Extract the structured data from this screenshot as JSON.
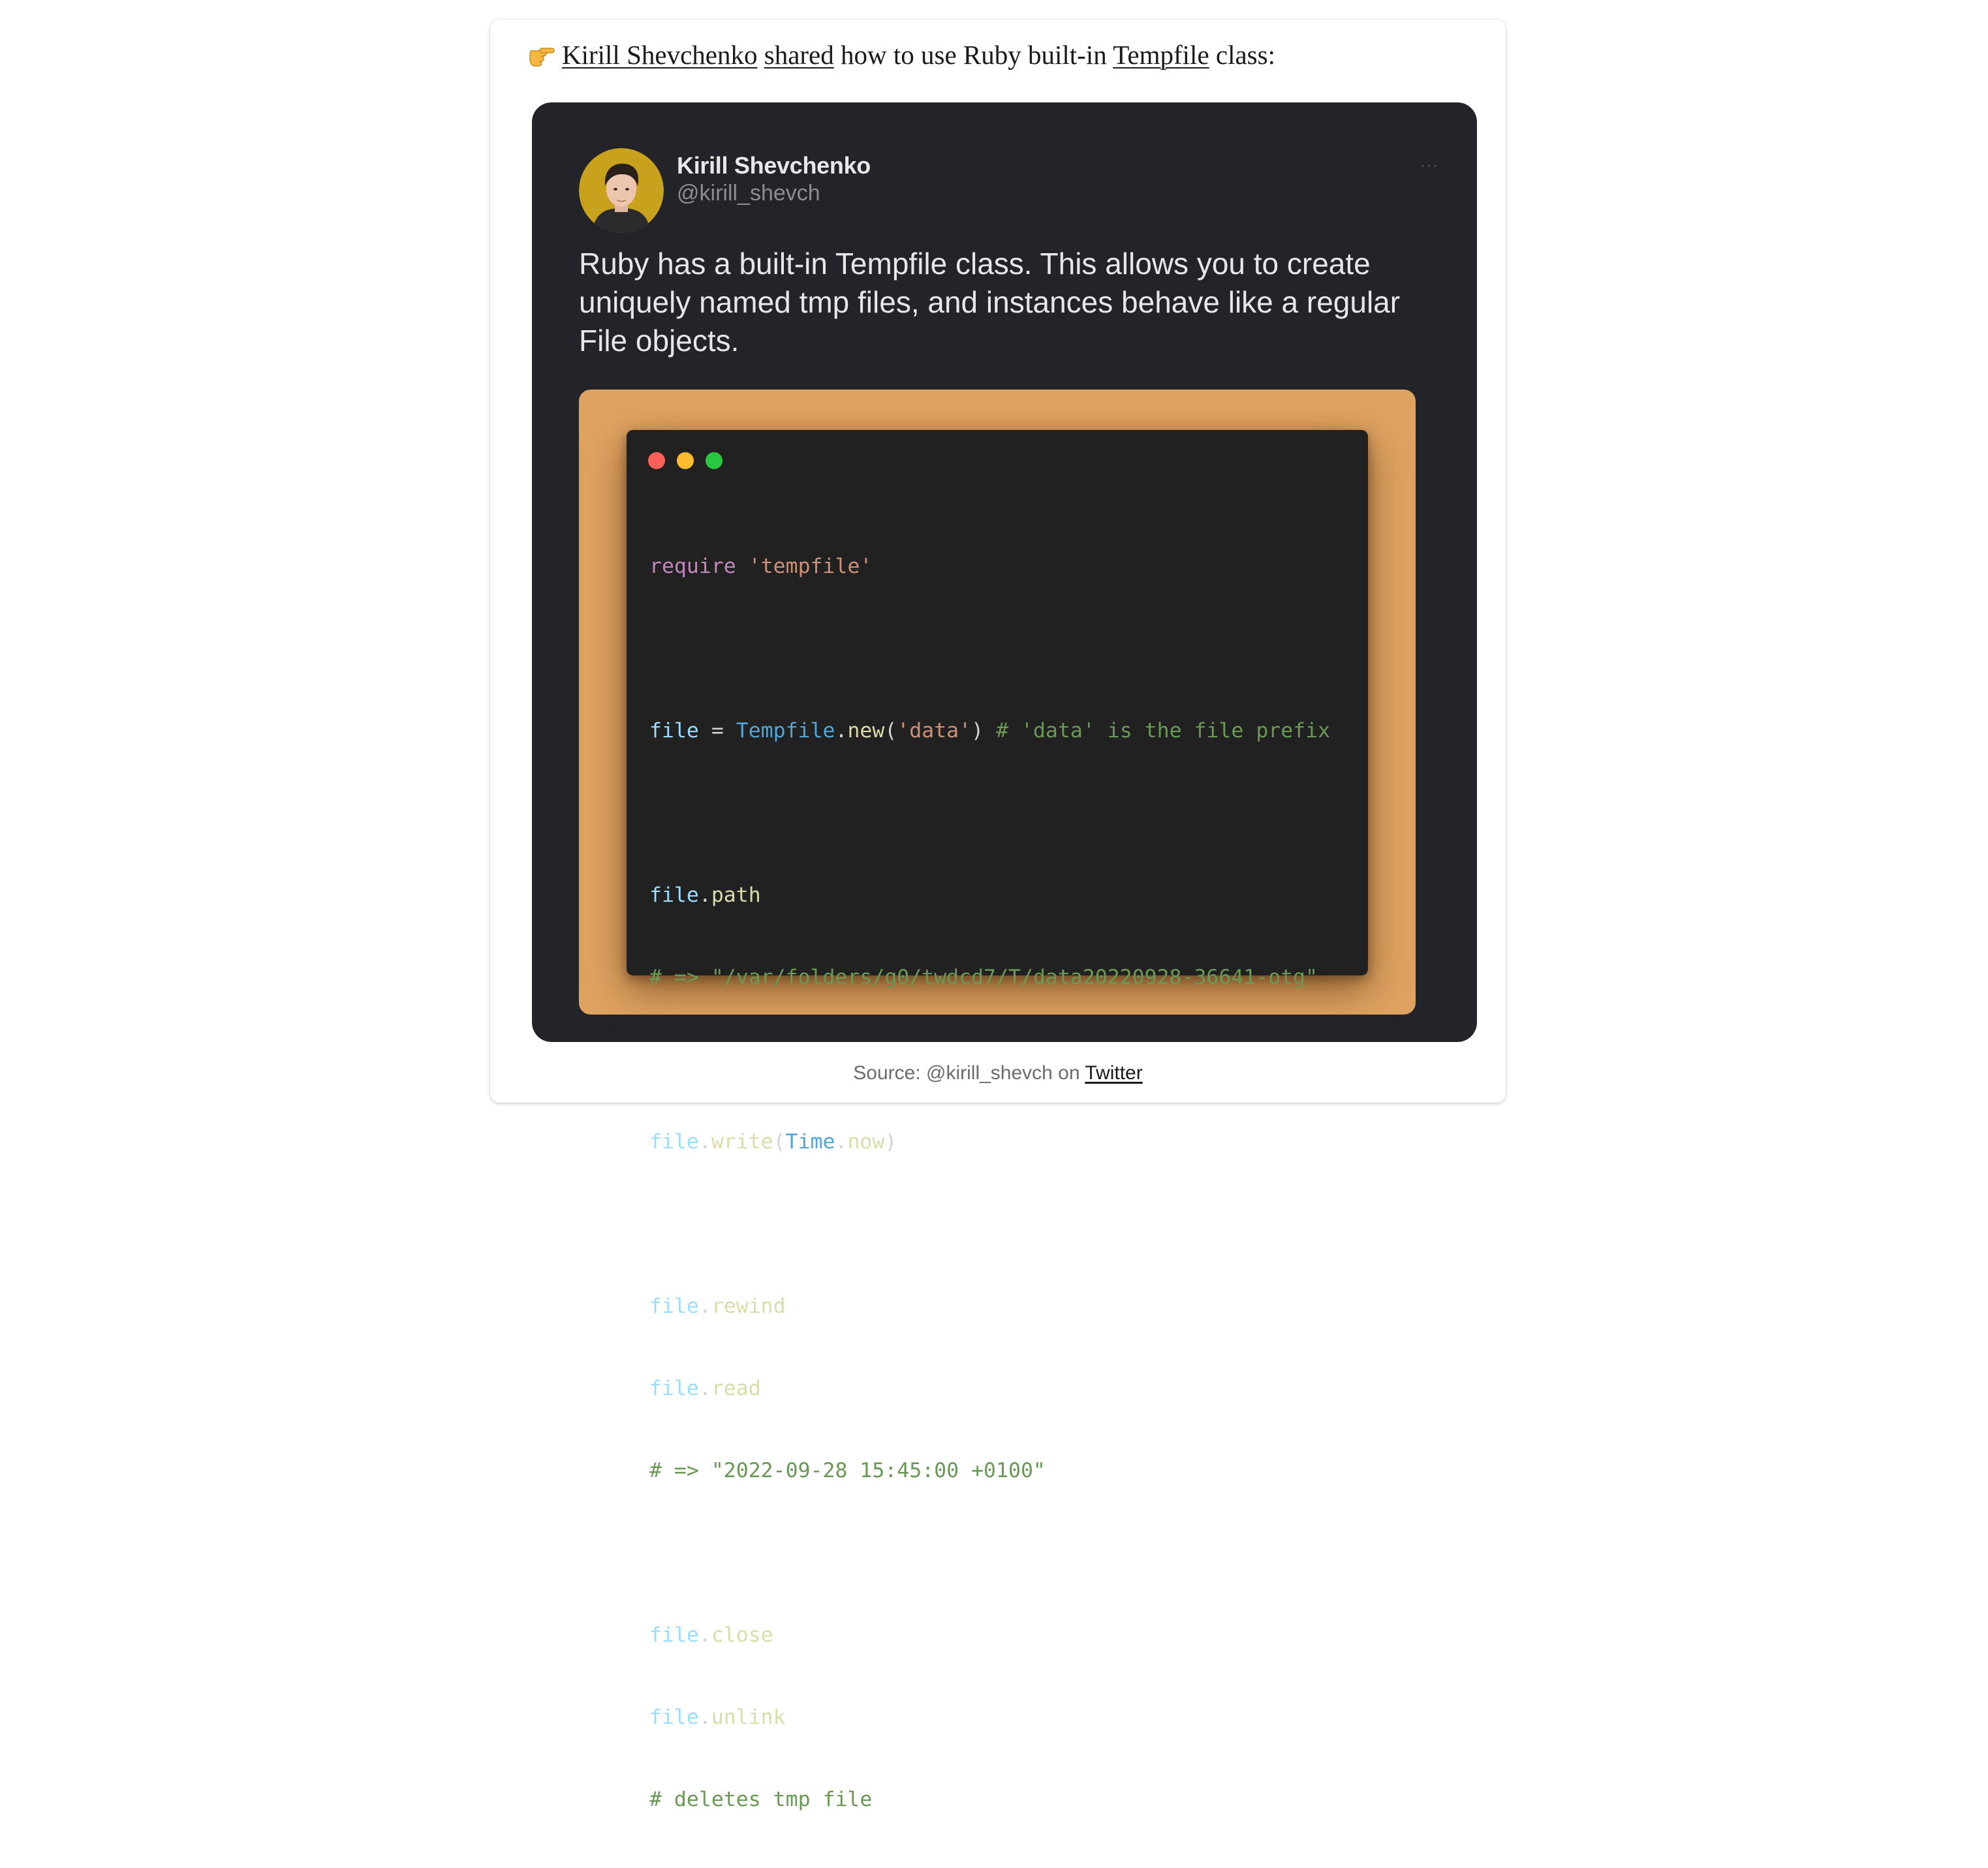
{
  "intro": {
    "emoji": "👉",
    "author_link": "Kirill Shevchenko",
    "shared_link": "shared",
    "text_a": " how to use Ruby built-in ",
    "tempfile_link": "Tempfile",
    "text_b": " class:"
  },
  "tweet": {
    "name": "Kirill Shevchenko",
    "handle": "@kirill_shevch",
    "more": "···",
    "text": "Ruby has a built-in Tempfile class. This allows you to create uniquely named tmp files, and instances behave like a regular File objects."
  },
  "code": {
    "l1_kw": "require",
    "l1_str": "'tempfile'",
    "l2_var": "file",
    "l2_eq": " = ",
    "l2_class": "Tempfile",
    "l2_dot": ".",
    "l2_method": "new",
    "l2_open": "(",
    "l2_str": "'data'",
    "l2_close": ") ",
    "l2_comment": "# 'data' is the file prefix",
    "l3_var": "file",
    "l3_dot": ".",
    "l3_method": "path",
    "l4_comment": "# => \"/var/folders/g0/twdcd7/T/data20220928-36641-otg\"",
    "l5_var": "file",
    "l5_dot": ".",
    "l5_method": "write",
    "l5_open": "(",
    "l5_class": "Time",
    "l5_dot2": ".",
    "l5_arg": "now",
    "l5_close": ")",
    "l6_var": "file",
    "l6_dot": ".",
    "l6_method": "rewind",
    "l7_var": "file",
    "l7_dot": ".",
    "l7_method": "read",
    "l8_comment": "# => \"2022-09-28 15:45:00 +0100\"",
    "l9_var": "file",
    "l9_dot": ".",
    "l9_method": "close",
    "l10_var": "file",
    "l10_dot": ".",
    "l10_method": "unlink",
    "l11_comment": "# deletes tmp file"
  },
  "source": {
    "prefix": "Source: @kirill_shevch on ",
    "link": "Twitter"
  },
  "colors": {
    "tweet_bg": "#22242a",
    "frame_orange": "#dfa361",
    "editor_bg": "#212121"
  }
}
